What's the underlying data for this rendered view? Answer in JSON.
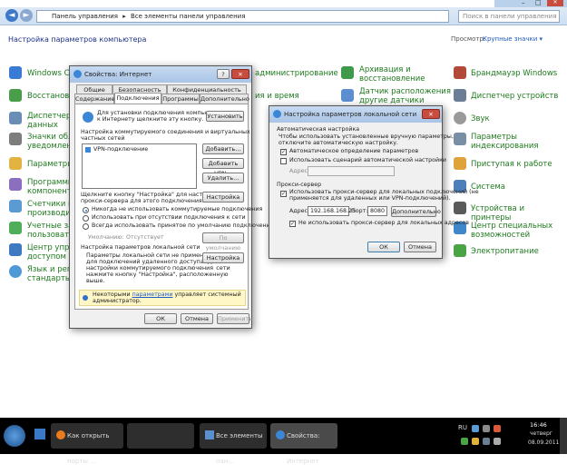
{
  "control_panel": {
    "address": {
      "segments": [
        "Панель управления",
        "Все элементы панели управления"
      ],
      "separator": "▸",
      "search_placeholder": "Поиск в панели управления"
    },
    "heading": "Настройка параметров компьютера",
    "view_label": "Просмотр:",
    "view_value": "Крупные значки ▾",
    "items_col1": [
      "Windows Ca",
      "Восстановле",
      "Диспетчер у",
      "данных",
      "Значки обла",
      "уведомлени",
      "Параметры",
      "Программы",
      "компоненть",
      "Счетчики и",
      "производит",
      "Учетные запи",
      "пользовател",
      "Центр управ",
      "доступом",
      "Язык и регио",
      "стандарты"
    ],
    "items_col2": [
      "администрирование",
      "ия и время"
    ],
    "items_col3": [
      "Архивация и",
      "восстановление",
      "Датчик расположения и",
      "другие датчики"
    ],
    "items_col4": [
      "Брандмауэр Windows",
      "Диспетчер устройств",
      "Звук",
      "Параметры",
      "индексирования",
      "Приступая к работе",
      "Система",
      "Устройства и принтеры",
      "Центр специальных",
      "возможностей",
      "Электропитание"
    ]
  },
  "internet_dialog": {
    "title": "Свойства: Интернет",
    "title_buttons": [
      "?",
      "✕"
    ],
    "tabs_row1": [
      "Общие",
      "Безопасность",
      "Конфиденциальность"
    ],
    "tabs_row2": [
      "Содержание",
      "Подключения",
      "Программы",
      "Дополнительно"
    ],
    "setup_text": [
      "Для установки подключения компьютера",
      "к Интернету щелкните эту кнопку."
    ],
    "setup_button": "Установить",
    "dialup_text": [
      "Настройка коммутируемого соединения и виртуальных",
      "частных сетей"
    ],
    "vpn_item": "VPN-подключение",
    "add_button": "Добавить...",
    "add_vpn_button": "Добавить VPN...",
    "delete_button": "Удалить...",
    "proxy_text": [
      "Щелкните кнопку \"Настройка\" для настройки",
      "прокси-сервера для этого подключения."
    ],
    "settings_button": "Настройка",
    "radio_options": [
      "Никогда не использовать коммутируемые подключения",
      "Использовать при отсутствии подключения к сети",
      "Всегда использовать принятое по умолчанию подключение"
    ],
    "default_label": "Умолчанию:",
    "default_value": "Отсутствует",
    "default_button": "По умолчанию",
    "lan_section_title": "Настройка параметров локальной сети",
    "lan_text": [
      "Параметры локальной сети не применяются",
      "для подключений удаленного доступа. Для",
      "настройки коммутируемого подключения",
      "нажмите кнопку \"Настройка\", расположенную",
      "выше."
    ],
    "lan_button": "Настройка сети",
    "info_text_1": "Некоторыми",
    "info_link": "параметрами",
    "info_text_2": "управляет системный",
    "info_text_3": "администратор.",
    "ok_button": "ОК",
    "cancel_button": "Отмена",
    "apply_button": "Применить"
  },
  "lan_dialog": {
    "title": "Настройка параметров локальной сети",
    "close_button": "✕",
    "auto_section": "Автоматическая настройка",
    "auto_text": [
      "Чтобы использовать установленные вручную параметры,",
      "отключите автоматическую настройку."
    ],
    "auto_detect_label": "Автоматическое определение параметров",
    "auto_script_label": "Использовать сценарий автоматической настройки",
    "address_label_short": "Адрес",
    "proxy_section": "Прокси-сервер",
    "proxy_use_label": [
      "Использовать прокси-сервер для локальных подключений (не",
      "применяется для удаленных или VPN-подключений)."
    ],
    "address_label": "Адрес:",
    "address_value": "192.168.168.25",
    "port_label": "Порт:",
    "port_value": "8080",
    "advanced_button": "Дополнительно",
    "bypass_label": "Не использовать прокси-сервер для локальных адресов",
    "ok_button": "ОК",
    "cancel_button": "Отмена"
  },
  "taskbar": {
    "tasks": [
      "Как открыть порты ...",
      "",
      "Все элементы пан...",
      "Свойства: Интернет"
    ],
    "lang": "RU",
    "time": "16:46",
    "day": "четверг",
    "date": "08.09.2011"
  },
  "colors": {
    "cp_link_green": "#1e7a1e",
    "heading_blue": "#1e3287",
    "taskbar": "#000000"
  }
}
